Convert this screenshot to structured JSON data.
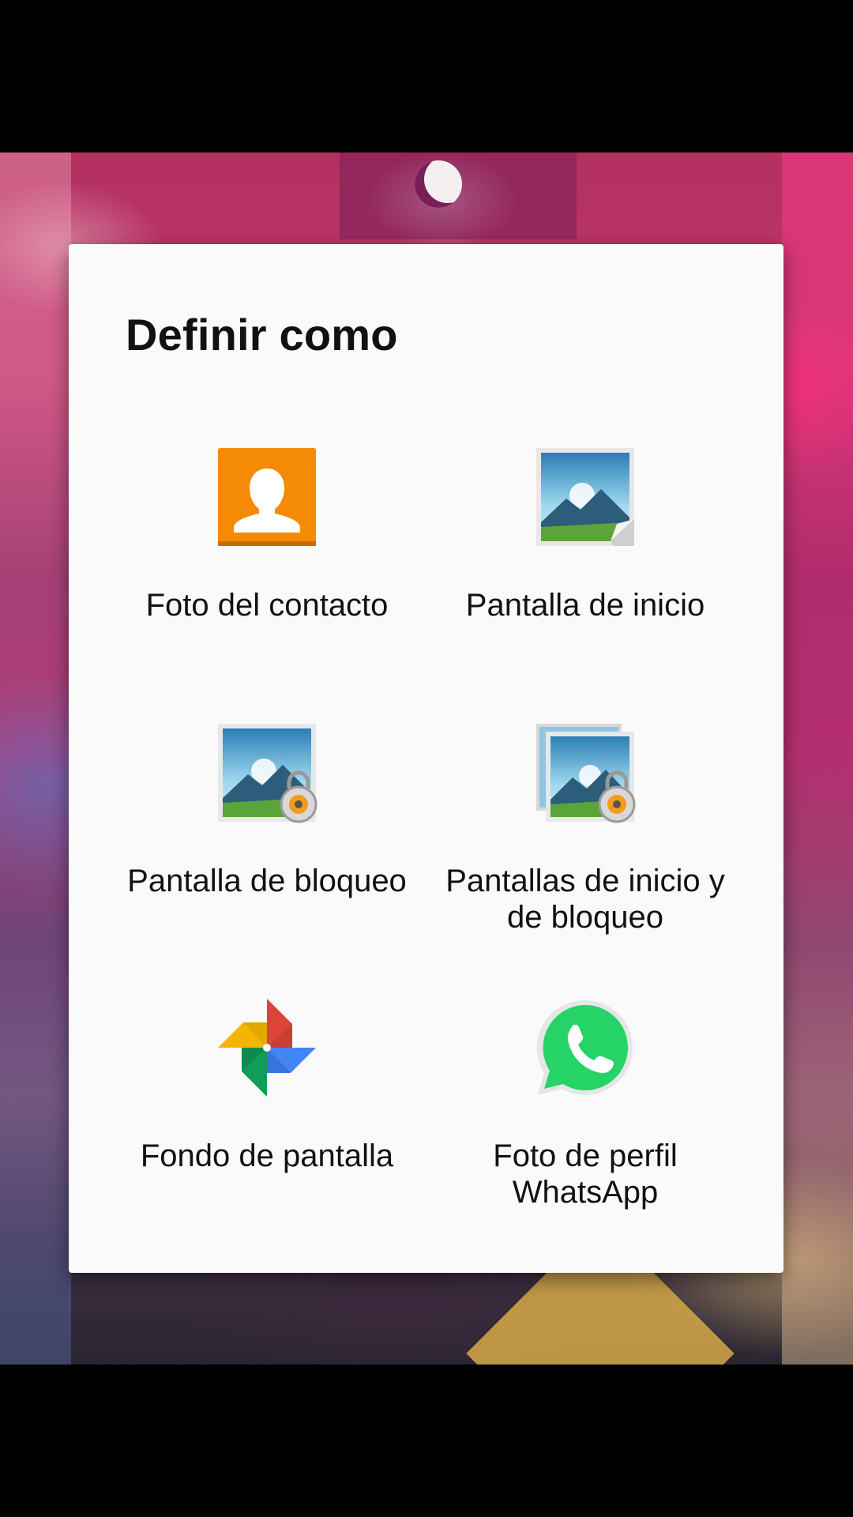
{
  "dialog": {
    "title": "Definir como",
    "options": [
      {
        "label": "Foto del contacto",
        "icon": "contact-photo-icon"
      },
      {
        "label": "Pantalla de inicio",
        "icon": "home-screen-wallpaper-icon"
      },
      {
        "label": "Pantalla de bloqueo",
        "icon": "lock-screen-wallpaper-icon"
      },
      {
        "label": "Pantallas de inicio y de bloqueo",
        "icon": "home-and-lock-screen-icon"
      },
      {
        "label": "Fondo de pantalla",
        "icon": "google-photos-pinwheel-icon"
      },
      {
        "label": "Foto de perfil WhatsApp",
        "icon": "whatsapp-icon"
      }
    ]
  },
  "colors": {
    "contact_orange": "#f58a07",
    "whatsapp_green": "#25d366",
    "dialog_bg": "#fafafa"
  }
}
